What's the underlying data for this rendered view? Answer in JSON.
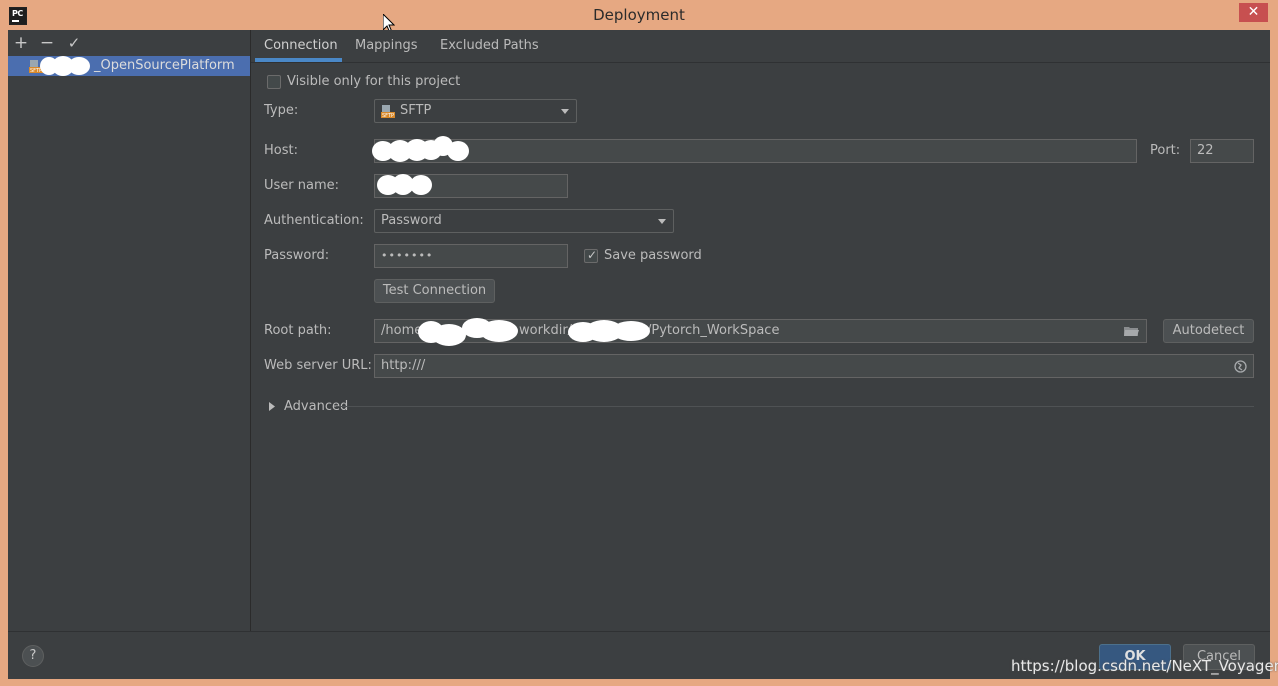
{
  "window": {
    "title": "Deployment",
    "close_glyph": "✕"
  },
  "left_toolbar": {
    "add": "+",
    "remove": "−",
    "apply": "✓"
  },
  "servers": [
    {
      "label": "_OpenSourcePlatform",
      "icon": "sftp-icon",
      "selected": true
    }
  ],
  "tabs": [
    {
      "label": "Connection",
      "active": true
    },
    {
      "label": "Mappings",
      "active": false
    },
    {
      "label": "Excluded Paths",
      "active": false
    }
  ],
  "connection": {
    "visible_only_label": "Visible only for this project",
    "visible_only_checked": false,
    "type_label": "Type:",
    "type_value": "SFTP",
    "host_label": "Host:",
    "host_value": "",
    "port_label": "Port:",
    "port_value": "22",
    "username_label": "User name:",
    "username_value": "",
    "auth_label": "Authentication:",
    "auth_value": "Password",
    "password_label": "Password:",
    "password_value": "•••••••",
    "save_password_label": "Save password",
    "save_password_checked": true,
    "test_connection_label": "Test Connection",
    "root_path_label": "Root path:",
    "root_path_prefix": "/home/",
    "root_path_mid": "workdir/",
    "root_path_suffix": "/Pytorch_WorkSpace",
    "autodetect_label": "Autodetect",
    "web_url_label": "Web server URL:",
    "web_url_value": "http:///",
    "advanced_label": "Advanced"
  },
  "bottom": {
    "help": "?",
    "ok": "OK",
    "cancel": "Cancel"
  },
  "watermark": "https://blog.csdn.net/NeXT_Voyager",
  "colors": {
    "accent": "#4b6eaf",
    "ok_button": "#365880",
    "title_bar": "#e6a882",
    "close_button": "#c75050",
    "background": "#3c3f41"
  }
}
